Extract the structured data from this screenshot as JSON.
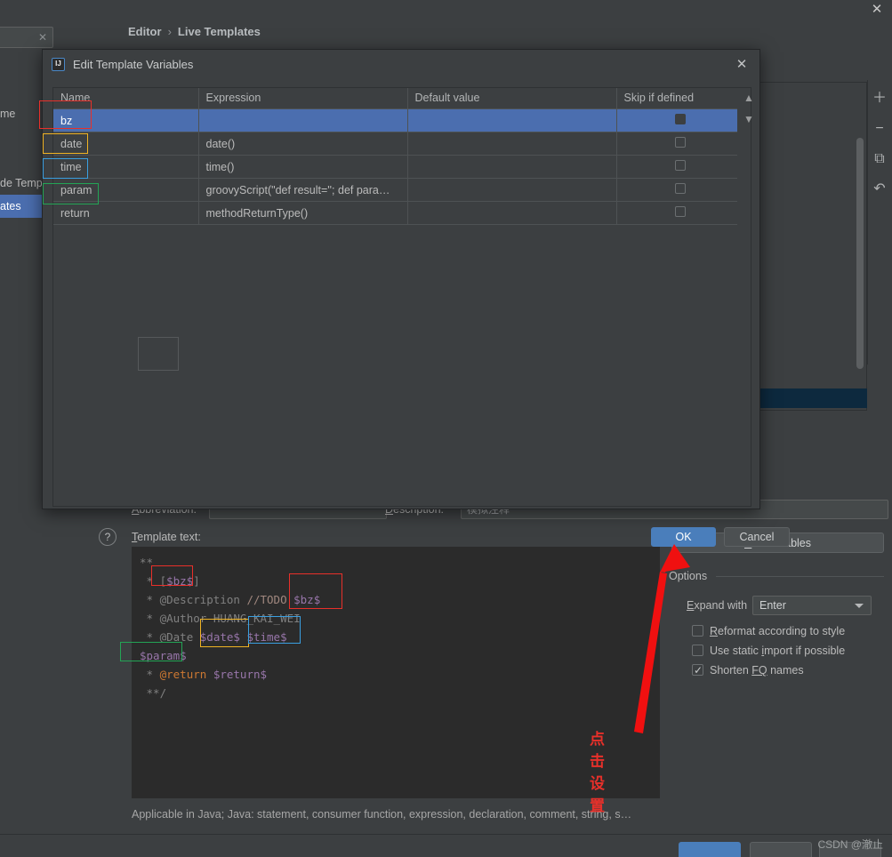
{
  "window": {
    "close_icon": "close-icon",
    "breadcrumb": {
      "parent": "Editor",
      "separator": "›",
      "current": "Live Templates"
    },
    "search_clear_icon": "clear-icon"
  },
  "sidebar": {
    "items": [
      {
        "label": "me",
        "selected": false
      },
      {
        "label": "",
        "selected": false
      },
      {
        "label": "",
        "selected": false
      },
      {
        "label": "de Temp",
        "selected": false
      },
      {
        "label": "ates",
        "selected": true
      }
    ]
  },
  "right_toolbar": {
    "buttons": [
      {
        "icon": "plus-icon",
        "glyph": "＋"
      },
      {
        "icon": "minus-icon",
        "glyph": "−"
      },
      {
        "icon": "copy-icon",
        "glyph": "⧉"
      },
      {
        "icon": "undo-icon",
        "glyph": "↶"
      }
    ]
  },
  "fields": {
    "abbreviation_label": "Abbreviation:",
    "abbreviation_value": "",
    "description_label": "Description:",
    "description_value": "模拟注释"
  },
  "template": {
    "label": "Template text:",
    "lines": [
      "**",
      " * [$bz$]",
      " * @Description //TODO $bz$",
      " * @Author HUANG_KAI_WEI",
      " * @Date $date$ $time$",
      "$param$",
      " * @return $return$",
      " **/"
    ],
    "applicable": "Applicable in Java; Java: statement, consumer function, expression, declaration, comment, string, s…"
  },
  "options": {
    "edit_variables_label": "Edit variables",
    "section_title": "Options",
    "expand_with_label": "Expand with",
    "expand_with_value": "Enter",
    "checkboxes": [
      {
        "label": "Reformat according to style",
        "checked": false
      },
      {
        "label": "Use static import if possible",
        "checked": false
      },
      {
        "label": "Shorten FQ names",
        "checked": true
      }
    ]
  },
  "dialog": {
    "title": "Edit Template Variables",
    "app_icon": "intellij-idea-icon",
    "close_icon": "close-icon",
    "columns": [
      "Name",
      "Expression",
      "Default value",
      "Skip if defined"
    ],
    "rows": [
      {
        "name": "bz",
        "expression": "",
        "default": "",
        "skip": false,
        "selected": true
      },
      {
        "name": "date",
        "expression": "date()",
        "default": "",
        "skip": false,
        "selected": false
      },
      {
        "name": "time",
        "expression": "time()",
        "default": "",
        "skip": false,
        "selected": false
      },
      {
        "name": "param",
        "expression": "groovyScript(\"def result=''; def para…",
        "default": "",
        "skip": false,
        "selected": false
      },
      {
        "name": "return",
        "expression": "methodReturnType()",
        "default": "",
        "skip": false,
        "selected": false
      }
    ],
    "scroll_up_icon": "arrow-up-icon",
    "scroll_down_icon": "arrow-down-icon",
    "help_label": "?",
    "ok_label": "OK",
    "cancel_label": "Cancel"
  },
  "annotations": {
    "callout_text": "点击设置",
    "colors": {
      "red": "#e8302a",
      "yellow": "#f0b323",
      "blue": "#3a9fe0",
      "green": "#23a455"
    }
  },
  "watermark": {
    "text": "CSDN @澈止"
  }
}
